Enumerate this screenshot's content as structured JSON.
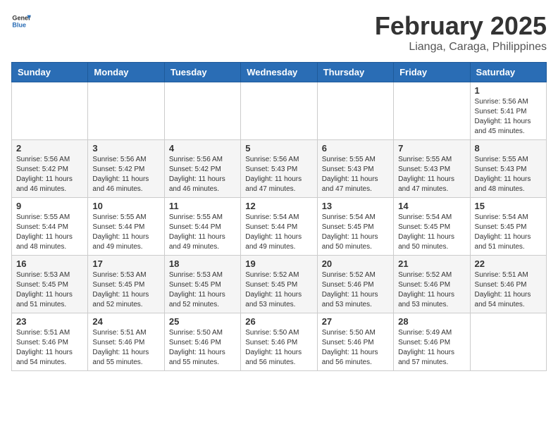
{
  "header": {
    "logo_general": "General",
    "logo_blue": "Blue",
    "month_year": "February 2025",
    "location": "Lianga, Caraga, Philippines"
  },
  "weekdays": [
    "Sunday",
    "Monday",
    "Tuesday",
    "Wednesday",
    "Thursday",
    "Friday",
    "Saturday"
  ],
  "weeks": [
    [
      {
        "day": "",
        "info": ""
      },
      {
        "day": "",
        "info": ""
      },
      {
        "day": "",
        "info": ""
      },
      {
        "day": "",
        "info": ""
      },
      {
        "day": "",
        "info": ""
      },
      {
        "day": "",
        "info": ""
      },
      {
        "day": "1",
        "info": "Sunrise: 5:56 AM\nSunset: 5:41 PM\nDaylight: 11 hours\nand 45 minutes."
      }
    ],
    [
      {
        "day": "2",
        "info": "Sunrise: 5:56 AM\nSunset: 5:42 PM\nDaylight: 11 hours\nand 46 minutes."
      },
      {
        "day": "3",
        "info": "Sunrise: 5:56 AM\nSunset: 5:42 PM\nDaylight: 11 hours\nand 46 minutes."
      },
      {
        "day": "4",
        "info": "Sunrise: 5:56 AM\nSunset: 5:42 PM\nDaylight: 11 hours\nand 46 minutes."
      },
      {
        "day": "5",
        "info": "Sunrise: 5:56 AM\nSunset: 5:43 PM\nDaylight: 11 hours\nand 47 minutes."
      },
      {
        "day": "6",
        "info": "Sunrise: 5:55 AM\nSunset: 5:43 PM\nDaylight: 11 hours\nand 47 minutes."
      },
      {
        "day": "7",
        "info": "Sunrise: 5:55 AM\nSunset: 5:43 PM\nDaylight: 11 hours\nand 47 minutes."
      },
      {
        "day": "8",
        "info": "Sunrise: 5:55 AM\nSunset: 5:43 PM\nDaylight: 11 hours\nand 48 minutes."
      }
    ],
    [
      {
        "day": "9",
        "info": "Sunrise: 5:55 AM\nSunset: 5:44 PM\nDaylight: 11 hours\nand 48 minutes."
      },
      {
        "day": "10",
        "info": "Sunrise: 5:55 AM\nSunset: 5:44 PM\nDaylight: 11 hours\nand 49 minutes."
      },
      {
        "day": "11",
        "info": "Sunrise: 5:55 AM\nSunset: 5:44 PM\nDaylight: 11 hours\nand 49 minutes."
      },
      {
        "day": "12",
        "info": "Sunrise: 5:54 AM\nSunset: 5:44 PM\nDaylight: 11 hours\nand 49 minutes."
      },
      {
        "day": "13",
        "info": "Sunrise: 5:54 AM\nSunset: 5:45 PM\nDaylight: 11 hours\nand 50 minutes."
      },
      {
        "day": "14",
        "info": "Sunrise: 5:54 AM\nSunset: 5:45 PM\nDaylight: 11 hours\nand 50 minutes."
      },
      {
        "day": "15",
        "info": "Sunrise: 5:54 AM\nSunset: 5:45 PM\nDaylight: 11 hours\nand 51 minutes."
      }
    ],
    [
      {
        "day": "16",
        "info": "Sunrise: 5:53 AM\nSunset: 5:45 PM\nDaylight: 11 hours\nand 51 minutes."
      },
      {
        "day": "17",
        "info": "Sunrise: 5:53 AM\nSunset: 5:45 PM\nDaylight: 11 hours\nand 52 minutes."
      },
      {
        "day": "18",
        "info": "Sunrise: 5:53 AM\nSunset: 5:45 PM\nDaylight: 11 hours\nand 52 minutes."
      },
      {
        "day": "19",
        "info": "Sunrise: 5:52 AM\nSunset: 5:45 PM\nDaylight: 11 hours\nand 53 minutes."
      },
      {
        "day": "20",
        "info": "Sunrise: 5:52 AM\nSunset: 5:46 PM\nDaylight: 11 hours\nand 53 minutes."
      },
      {
        "day": "21",
        "info": "Sunrise: 5:52 AM\nSunset: 5:46 PM\nDaylight: 11 hours\nand 53 minutes."
      },
      {
        "day": "22",
        "info": "Sunrise: 5:51 AM\nSunset: 5:46 PM\nDaylight: 11 hours\nand 54 minutes."
      }
    ],
    [
      {
        "day": "23",
        "info": "Sunrise: 5:51 AM\nSunset: 5:46 PM\nDaylight: 11 hours\nand 54 minutes."
      },
      {
        "day": "24",
        "info": "Sunrise: 5:51 AM\nSunset: 5:46 PM\nDaylight: 11 hours\nand 55 minutes."
      },
      {
        "day": "25",
        "info": "Sunrise: 5:50 AM\nSunset: 5:46 PM\nDaylight: 11 hours\nand 55 minutes."
      },
      {
        "day": "26",
        "info": "Sunrise: 5:50 AM\nSunset: 5:46 PM\nDaylight: 11 hours\nand 56 minutes."
      },
      {
        "day": "27",
        "info": "Sunrise: 5:50 AM\nSunset: 5:46 PM\nDaylight: 11 hours\nand 56 minutes."
      },
      {
        "day": "28",
        "info": "Sunrise: 5:49 AM\nSunset: 5:46 PM\nDaylight: 11 hours\nand 57 minutes."
      },
      {
        "day": "",
        "info": ""
      }
    ]
  ]
}
